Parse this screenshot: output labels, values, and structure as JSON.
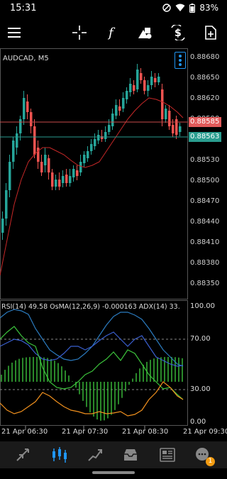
{
  "status": {
    "time": "15:31",
    "battery": "83%"
  },
  "toolbar": {
    "menu_icon": "menu-icon",
    "crosshair_icon": "crosshair-icon",
    "function_icon": "function-icon",
    "objects_icon": "objects-icon",
    "symbol_icon": "symbol-dollar-icon",
    "add_icon": "add-document-icon"
  },
  "chart": {
    "symbol_label": "AUDCAD, M5",
    "price_ticks": [
      "0.88680",
      "0.88650",
      "0.88620",
      "0.88590",
      "0.88560",
      "0.88530",
      "0.88500",
      "0.88470",
      "0.88440",
      "0.88410",
      "0.88380",
      "0.88350"
    ],
    "bid_tag": "0.88585",
    "ask_tag": "0.88563",
    "bid_color": "#e05a5a",
    "ask_color": "#2a9d8f",
    "bull_color": "#26a69a",
    "bear_color": "#ef5350",
    "ma_color": "#d62f2f"
  },
  "indicator": {
    "label": "RSI(14) 49.58 OsMA(12,26,9) -0.000163 ADX(14) 33.",
    "levels": [
      "100.00",
      "70.00",
      "30.00",
      "0.00"
    ]
  },
  "time_axis": [
    "21 Apr 06:30",
    "21 Apr 07:30",
    "21 Apr 08:30",
    "21 Apr 09:30"
  ],
  "nav": [
    "trade-icon",
    "chart-candles-icon",
    "history-icon",
    "inbox-icon",
    "news-icon",
    "chat-icon"
  ],
  "nav_badge": "1",
  "accent": "#2196f3"
}
